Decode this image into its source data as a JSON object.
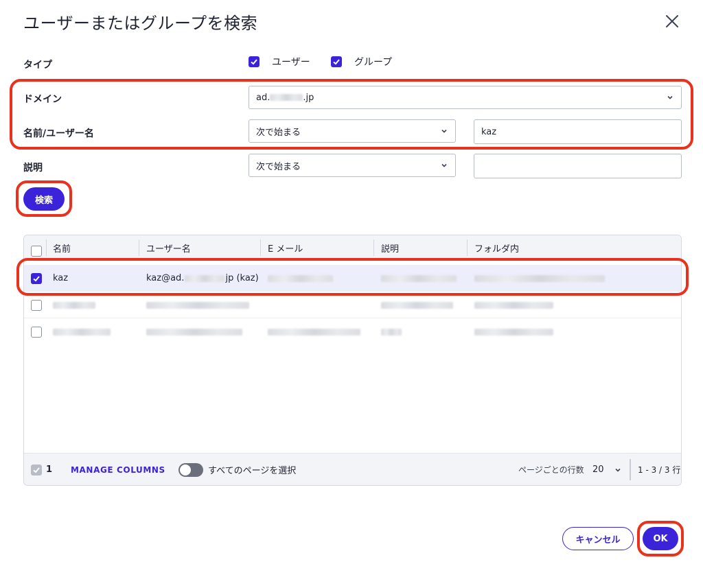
{
  "dialog": {
    "title": "ユーザーまたはグループを検索"
  },
  "form": {
    "type_label": "タイプ",
    "type_options": [
      {
        "label": "ユーザー",
        "checked": true
      },
      {
        "label": "グループ",
        "checked": true
      }
    ],
    "domain_label": "ドメイン",
    "domain_value_prefix": "ad.",
    "domain_value_suffix": ".jp",
    "name_label": "名前/ユーザー名",
    "name_match": "次で始まる",
    "name_value": "kaz",
    "desc_label": "説明",
    "desc_match": "次で始まる",
    "desc_value": "",
    "search_button": "検索"
  },
  "table": {
    "columns": [
      "名前",
      "ユーザー名",
      "E メール",
      "説明",
      "フォルダ内"
    ],
    "rows": [
      {
        "selected": true,
        "name": "kaz",
        "username_prefix": "kaz@ad.",
        "username_suffix": "jp (kaz)"
      },
      {
        "selected": false
      },
      {
        "selected": false
      }
    ],
    "footer": {
      "selected_count": "1",
      "manage_columns": "MANAGE COLUMNS",
      "select_all_pages": "すべてのページを選択",
      "rows_per_page_label": "ページごとの行数",
      "rows_per_page": "20",
      "range": "1 - 3 / 3 行"
    }
  },
  "actions": {
    "cancel": "キャンセル",
    "ok": "OK"
  },
  "colors": {
    "accent": "#3a23d9",
    "highlight": "#e8321d"
  }
}
